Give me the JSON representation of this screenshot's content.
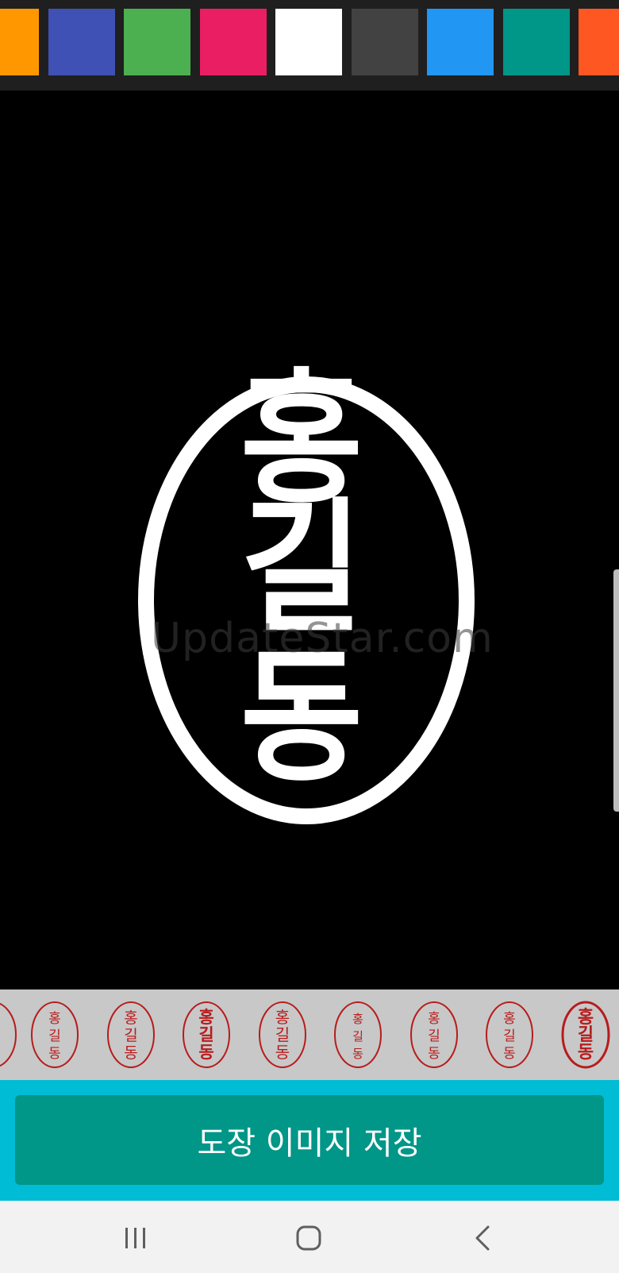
{
  "palette": {
    "swatches": [
      {
        "name": "orange",
        "color": "#ff9800"
      },
      {
        "name": "indigo",
        "color": "#3f51b5"
      },
      {
        "name": "green",
        "color": "#4caf50"
      },
      {
        "name": "pink",
        "color": "#e91e63"
      },
      {
        "name": "white",
        "color": "#ffffff"
      },
      {
        "name": "dark-gray",
        "color": "#424242"
      },
      {
        "name": "blue",
        "color": "#2196f3"
      },
      {
        "name": "teal",
        "color": "#009688"
      },
      {
        "name": "deep-orange",
        "color": "#ff5722"
      }
    ]
  },
  "stamp": {
    "text": "홍길동",
    "chars": [
      "홍",
      "길",
      "동"
    ],
    "stamp_color": "#ffffff",
    "background_color": "#000000"
  },
  "watermark": {
    "text": "UpdateStar.com"
  },
  "styles": {
    "stamp_color": "#b71c1c",
    "items": [
      {
        "text": "홍길동",
        "style": "vertical-small"
      },
      {
        "text": "홍길동",
        "style": "vertical-medium"
      },
      {
        "text": "홍길동",
        "style": "vertical-bold"
      },
      {
        "text": "홍길동",
        "style": "vertical-round"
      },
      {
        "text": "홍길동",
        "style": "vertical-thin"
      },
      {
        "text": "홍길동",
        "style": "vertical-script"
      },
      {
        "text": "홍길동",
        "style": "vertical-light"
      },
      {
        "text": "홍길동",
        "style": "vertical-heavy"
      }
    ]
  },
  "actions": {
    "save_label": "도장 이미지 저장"
  },
  "colors": {
    "save_area_bg": "#00bcd4",
    "save_button_bg": "#009688",
    "strip_bg": "#c8c8c8",
    "nav_bg": "#f2f2f2"
  }
}
